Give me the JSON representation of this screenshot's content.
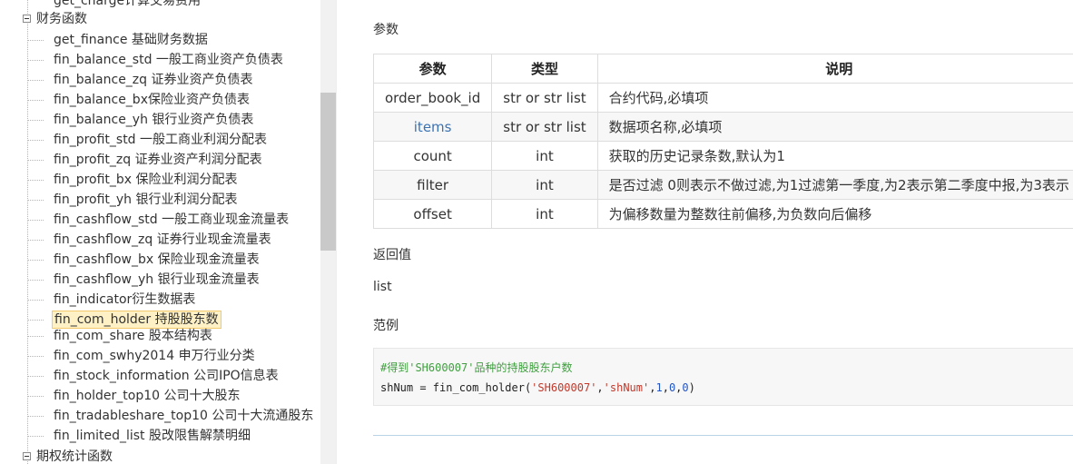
{
  "sidebar": {
    "top_partial": "get_charge计算交易费用",
    "category_finance": "财务函数",
    "items": [
      "get_finance 基础财务数据",
      "fin_balance_std 一般工商业资产负债表",
      "fin_balance_zq 证券业资产负债表",
      "fin_balance_bx保险业资产负债表",
      "fin_balance_yh 银行业资产负债表",
      "fin_profit_std 一般工商业利润分配表",
      "fin_profit_zq 证券业资产利润分配表",
      "fin_profit_bx 保险业利润分配表",
      "fin_profit_yh 银行业利润分配表",
      "fin_cashflow_std 一般工商业现金流量表",
      "fin_cashflow_zq 证券行业现金流量表",
      "fin_cashflow_bx 保险业现金流量表",
      "fin_cashflow_yh 银行业现金流量表",
      "fin_indicator衍生数据表",
      "fin_com_holder 持股股东数",
      "fin_com_share 股本结构表",
      "fin_com_swhy2014 申万行业分类",
      "fin_stock_information 公司IPO信息表",
      "fin_holder_top10 公司十大股东",
      "fin_tradableshare_top10 公司十大流通股东",
      "fin_limited_list 股改限售解禁明细"
    ],
    "selected_index": 14,
    "category_options": "期权统计函数"
  },
  "content": {
    "params_heading": "参数",
    "table": {
      "headers": [
        "参数",
        "类型",
        "说明"
      ],
      "rows": [
        [
          "order_book_id",
          "str or str list",
          "合约代码,必填项"
        ],
        [
          "items",
          "str or str list",
          "数据项名称,必填项"
        ],
        [
          "count",
          "int",
          "获取的历史记录条数,默认为1"
        ],
        [
          "filter",
          "int",
          "是否过滤 0则表示不做过滤,为1过滤第一季度,为2表示第二季度中报,为3表示"
        ],
        [
          "offset",
          "int",
          "为偏移数量为整数往前偏移,为负数向后偏移"
        ]
      ]
    },
    "return_heading": "返回值",
    "return_value": "list",
    "example_heading": "范例",
    "code": {
      "comment": "#得到'SH600007'品种的持股股东户数",
      "line_prefix": "shNum = fin_com_holder(",
      "arg1": "'SH600007'",
      "comma1": ",",
      "arg2": "'shNum'",
      "comma2": ",",
      "n1": "1",
      "comma3": ",",
      "n2": "0",
      "comma4": ",",
      "n3": "0",
      "close": ")"
    }
  },
  "colors": {
    "selected_bg": "#fff1c6",
    "link": "#3a73b5",
    "comment": "#3f9f3f",
    "string": "#c0392b",
    "number": "#2255c4"
  }
}
